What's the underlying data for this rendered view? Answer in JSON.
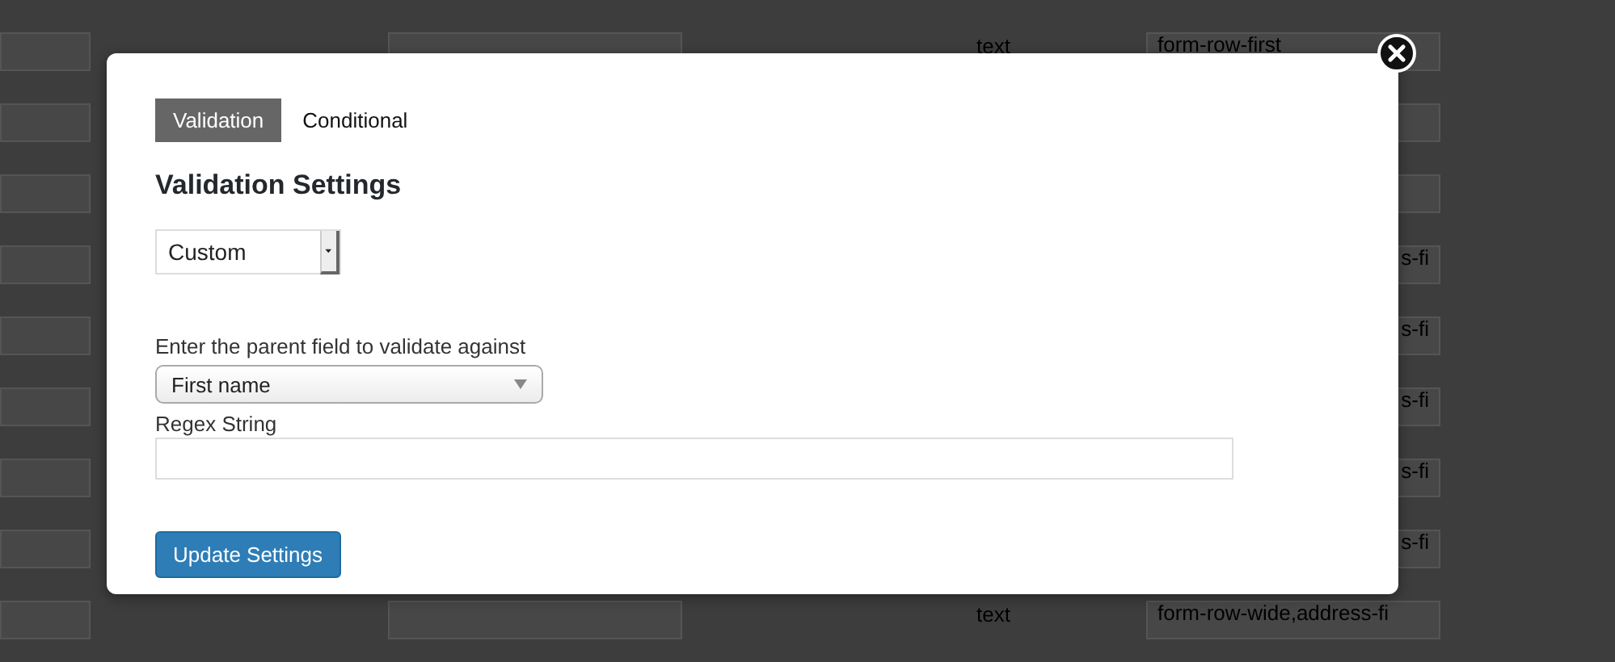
{
  "background_table": {
    "rows": [
      {
        "type": "text",
        "css_class": "form-row-first",
        "cut_left": false
      },
      {},
      {},
      {
        "css_class": "s-fi",
        "cut_left": true
      },
      {
        "css_class": "s-fi",
        "cut_left": true
      },
      {
        "css_class": "s-fi",
        "cut_left": true
      },
      {
        "css_class": "s-fi",
        "cut_left": true
      },
      {
        "css_class": "s-fi",
        "cut_left": true
      },
      {
        "type": "text",
        "css_class": "form-row-wide,address-fi",
        "cut_left": false
      }
    ]
  },
  "modal": {
    "tabs": [
      {
        "label": "Validation",
        "selected": true
      },
      {
        "label": "Conditional",
        "selected": false
      }
    ],
    "heading": "Validation Settings",
    "validation_select": {
      "value": "Custom"
    },
    "parent_field": {
      "label": "Enter the parent field to validate against",
      "value": "First name"
    },
    "regex": {
      "label": "Regex String"
    },
    "button": "Update Settings"
  }
}
